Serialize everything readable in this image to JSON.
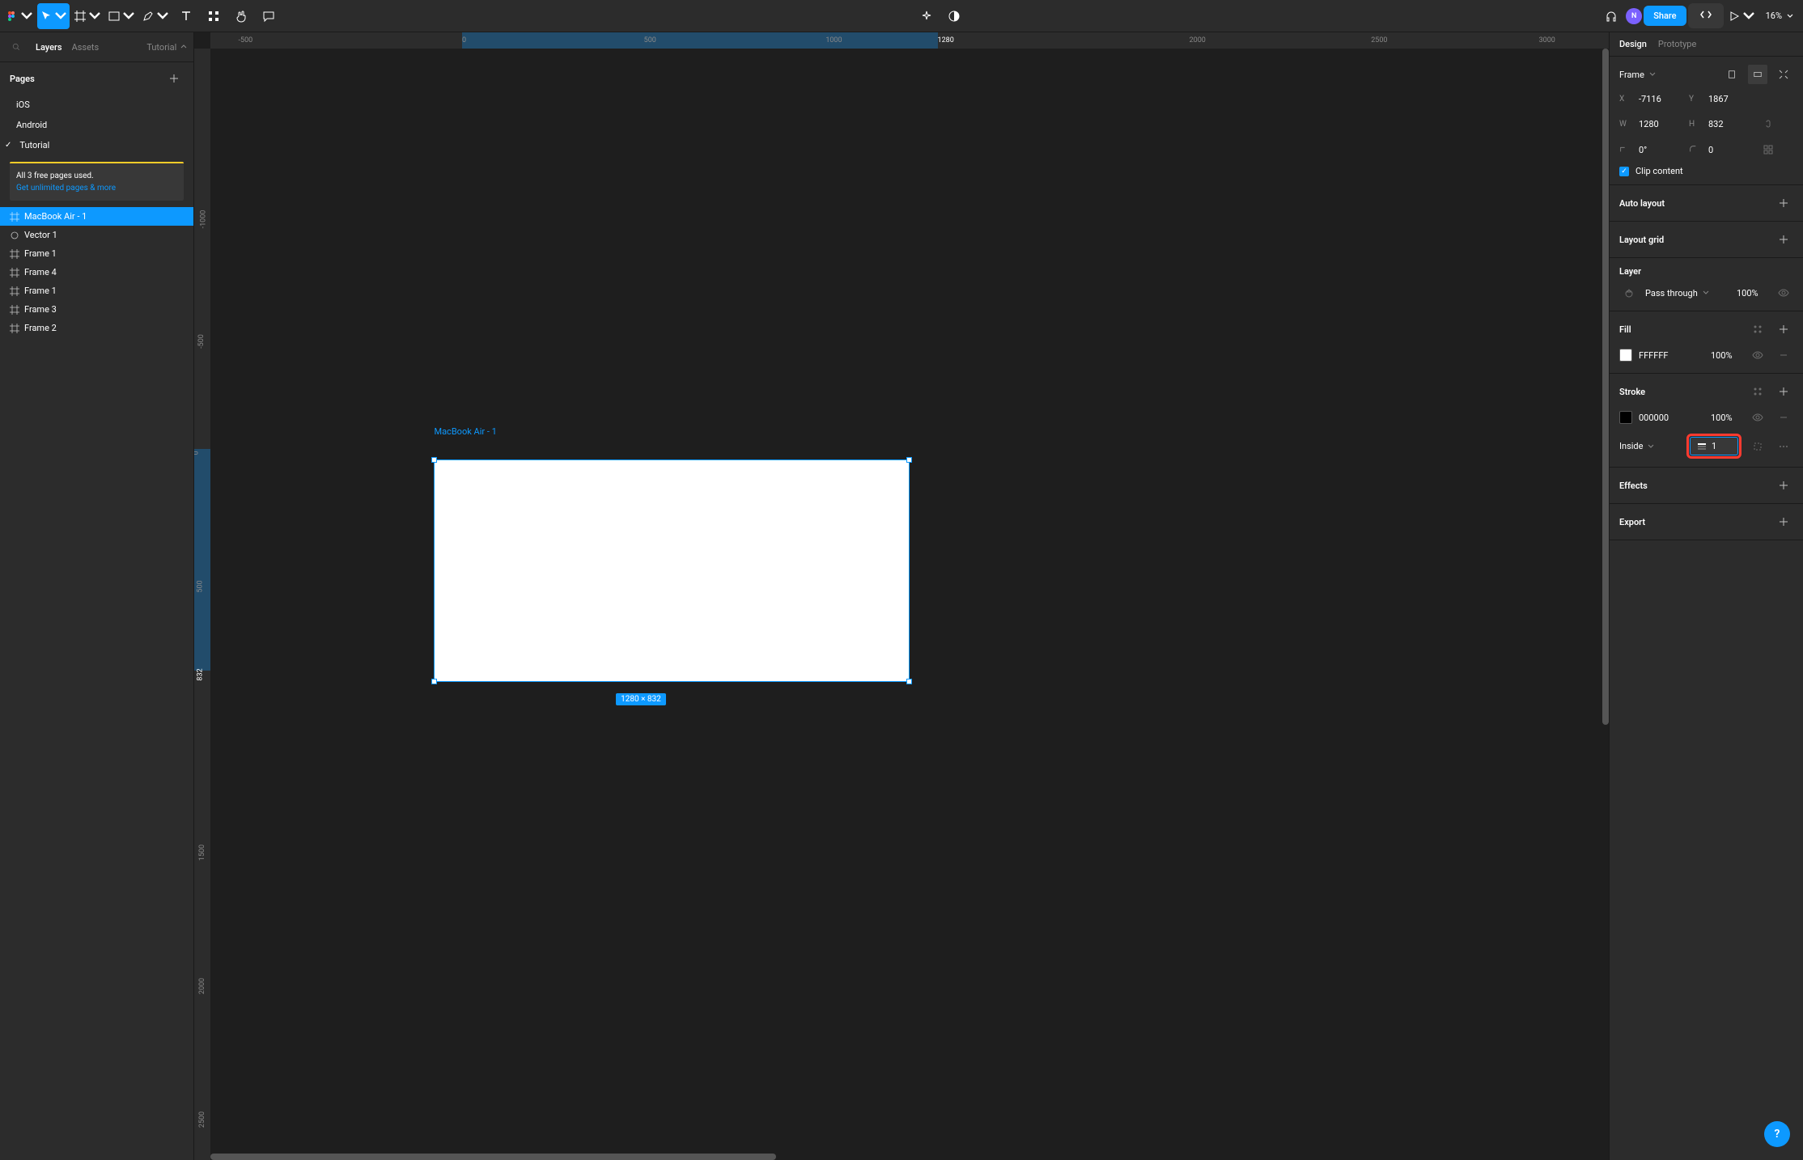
{
  "toolbar": {
    "share_label": "Share",
    "avatar_initial": "N",
    "zoom": "16%"
  },
  "left_panel": {
    "tabs": {
      "layers": "Layers",
      "assets": "Assets"
    },
    "file_name": "Tutorial",
    "pages_label": "Pages",
    "pages": [
      {
        "name": "iOS"
      },
      {
        "name": "Android"
      },
      {
        "name": "Tutorial"
      }
    ],
    "banner": {
      "line1": "All 3 free pages used.",
      "link": "Get unlimited pages & more"
    },
    "layers": [
      {
        "name": "MacBook Air - 1",
        "icon": "frame",
        "selected": true
      },
      {
        "name": "Vector 1",
        "icon": "vector"
      },
      {
        "name": "Frame 1",
        "icon": "frame"
      },
      {
        "name": "Frame 4",
        "icon": "frame"
      },
      {
        "name": "Frame 1",
        "icon": "frame"
      },
      {
        "name": "Frame 3",
        "icon": "frame"
      },
      {
        "name": "Frame 2",
        "icon": "frame"
      }
    ]
  },
  "canvas": {
    "ruler_h": [
      "-500",
      "0",
      "500",
      "1000",
      "1280",
      "2000",
      "2500",
      "3000"
    ],
    "ruler_v": [
      "-1000",
      "-500",
      "0",
      "500",
      "832",
      "1500",
      "2000",
      "2500"
    ],
    "frame_label": "MacBook Air - 1",
    "dimension_label": "1280 × 832"
  },
  "right_panel": {
    "tabs": {
      "design": "Design",
      "prototype": "Prototype"
    },
    "frame_label": "Frame",
    "position": {
      "x": "-7116",
      "y": "1867"
    },
    "size": {
      "w": "1280",
      "h": "832"
    },
    "rotation": "0°",
    "corner_radius": "0",
    "clip_content_label": "Clip content",
    "auto_layout_label": "Auto layout",
    "layout_grid_label": "Layout grid",
    "layer_label": "Layer",
    "blend_mode": "Pass through",
    "layer_opacity": "100%",
    "fill_label": "Fill",
    "fill_color": "FFFFFF",
    "fill_opacity": "100%",
    "stroke_label": "Stroke",
    "stroke_color": "000000",
    "stroke_opacity": "100%",
    "stroke_side": "Inside",
    "stroke_width": "1",
    "effects_label": "Effects",
    "export_label": "Export"
  },
  "help_label": "?"
}
